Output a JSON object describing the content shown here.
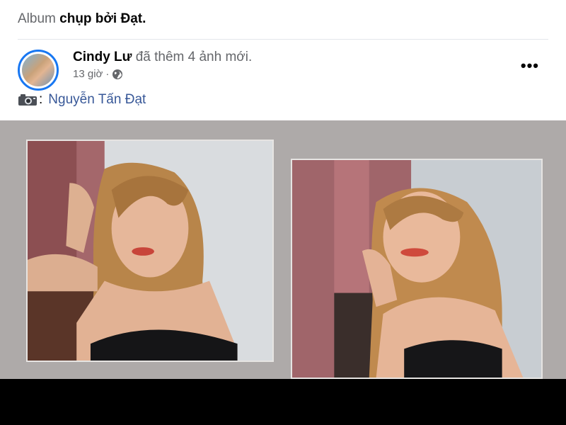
{
  "album": {
    "prefix": "Album",
    "name": "chụp bởi Đạt."
  },
  "post": {
    "author": "Cindy Lư",
    "action": "đã thêm 4 ảnh mới.",
    "time": "13 giờ",
    "separator": "·",
    "privacy_icon": "globe-icon",
    "more_label": "•••"
  },
  "credit": {
    "icon": "camera-icon",
    "colon": ":",
    "name": "Nguyễn Tấn Đạt"
  },
  "photos": [
    {
      "alt": "photo-1"
    },
    {
      "alt": "photo-2"
    }
  ],
  "colors": {
    "link": "#385898",
    "accent": "#1877f2",
    "photo_bg": "#aeaaa9"
  }
}
